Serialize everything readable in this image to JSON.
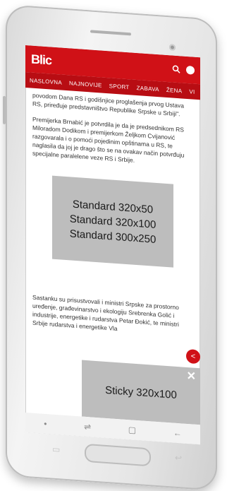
{
  "header": {
    "logo": "Blic",
    "icons": [
      "search-icon",
      "user-icon"
    ]
  },
  "nav": {
    "items": [
      {
        "label": "NASLOVNA"
      },
      {
        "label": "NAJNOVIJE"
      },
      {
        "label": "SPORT"
      },
      {
        "label": "ZABAVA"
      },
      {
        "label": "ŽENA"
      },
      {
        "label": "VI"
      }
    ]
  },
  "article": {
    "paragraph1": "povodom Dana RS i godišnjice proglašenja prvog Ustava RS, priređuje predstavništvo Republike Srpske u Srbiji\".",
    "paragraph2": "Premijerka Brnabić je potvrdila je da je predsednikom RS Miloradom Dodikom i premijerkom Željkom Cvijanović razgovarala i o pomoći pojedinim opštinama u RS, te naglasila da joj je drago što se na ovakav način potvrđuju specijalne paralelene veze RS i Srbije.",
    "paragraph3": "Sastanku su prisustvovali i ministri Srpske za prostorno uređenje, građevinarstvo i ekologiju Srebrenka Golić i industrije, energetike i rudarstva Petar Đokić, te ministri Srbije rudarstva i energetike Vla"
  },
  "ads": {
    "block_lines": [
      "Standard 320x50",
      "Standard 320x100",
      "Standard 300x250"
    ],
    "sticky_label": "Sticky 320x100",
    "close_symbol": "✕"
  },
  "system_nav": {
    "left": "•",
    "back_recent": "⇌",
    "home": "▢",
    "back": "←"
  },
  "colors": {
    "brand_red": "#d01117",
    "ad_gray": "#bdbdbd"
  }
}
